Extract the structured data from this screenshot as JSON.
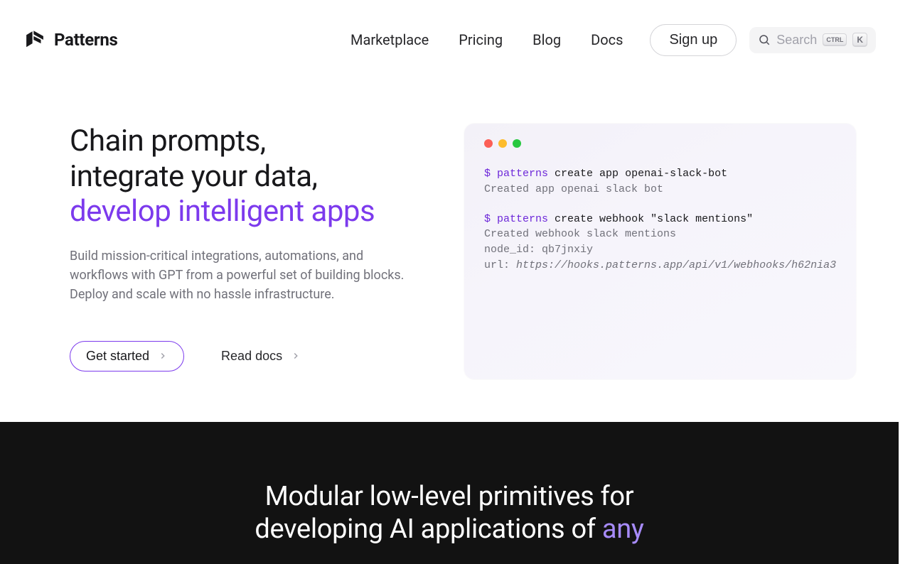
{
  "brand": {
    "name": "Patterns"
  },
  "nav": {
    "links": [
      "Marketplace",
      "Pricing",
      "Blog",
      "Docs"
    ],
    "signup": "Sign up",
    "search_placeholder": "Search",
    "kbd_ctrl": "CTRL",
    "kbd_k": "K"
  },
  "hero": {
    "title_l1": "Chain prompts,",
    "title_l2": "integrate your data,",
    "title_l3": "develop intelligent apps",
    "subtitle": "Build mission-critical integrations, automations, and workflows with GPT from a powerful set of building blocks. Deploy and scale with no hassle infrastructure.",
    "cta_primary": "Get started",
    "cta_secondary": "Read docs"
  },
  "terminal": {
    "prompt": "$",
    "cmd": "patterns",
    "line1_args": " create app openai-slack-bot",
    "line1_out": "Created app openai slack bot",
    "line2_args": " create webhook \"slack mentions\"",
    "line2_out1": "Created webhook slack mentions",
    "line2_out2": "node_id: qb7jnxiy",
    "line2_out3_prefix": "url: ",
    "line2_out3_url": "https://hooks.patterns.app/api/v1/webhooks/h62nia3"
  },
  "dark_section": {
    "h_line1": "Modular low-level primitives for",
    "h_line2_a": "developing AI applications of ",
    "h_line2_b": "any"
  }
}
